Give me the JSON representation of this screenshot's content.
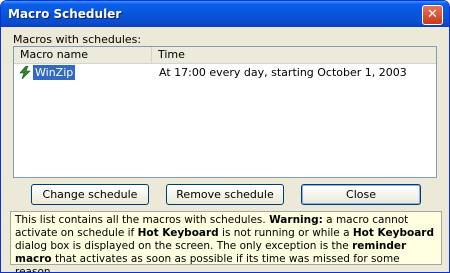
{
  "window": {
    "title": "Macro Scheduler",
    "close_glyph": "✕"
  },
  "group_label": "Macros with schedules:",
  "list": {
    "columns": [
      "Macro name",
      "Time"
    ],
    "rows": [
      {
        "name": "WinZip",
        "time": "At 17:00 every day, starting October 1, 2003",
        "icon": "lightning-icon"
      }
    ]
  },
  "buttons": {
    "change_schedule": "Change schedule",
    "remove_schedule": "Remove schedule",
    "close": "Close"
  },
  "info": {
    "t1": "This list contains all the macros with schedules. ",
    "warning": "Warning:",
    "t2": " a macro cannot activate on schedule if ",
    "hk1": "Hot Keyboard",
    "t3": " is not running or while a ",
    "hk2": "Hot Keyboard",
    "t4": " dialog box is displayed on the screen. The only exception is the ",
    "reminder": "reminder macro",
    "t5": " that activates as soon as possible if its time was missed for some reason."
  },
  "colors": {
    "titlebar": "#0556dc",
    "selection": "#316ac5",
    "info_bg": "#ffffe1"
  }
}
